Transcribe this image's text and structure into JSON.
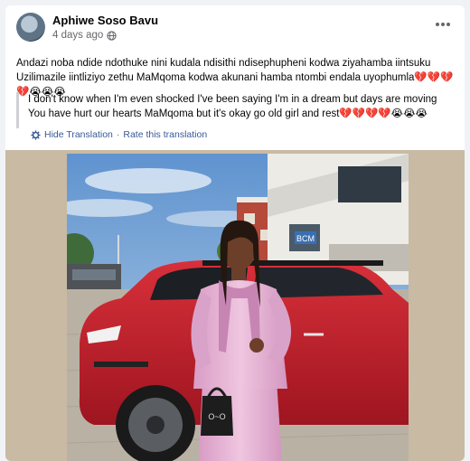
{
  "post": {
    "author": "Aphiwe Soso Bavu",
    "time": "4 days ago",
    "text_line1": "Andazi noba ndide ndothuke nini kudala ndisithi ndisephupheni kodwa ziyahamba iintsuku",
    "text_line2": "Uzilimazile iintliziyo zethu MaMqoma kodwa akunani hamba ntombi endala uyophumla",
    "emoji_line1_end": "💔💔💔",
    "emoji_line3": "💔😭😭😭",
    "translation_line1": "I don't know when I'm even shocked I've been saying I'm in a dream but days are moving",
    "translation_line2": "You have hurt our hearts MaMqoma but it's okay go old girl and rest",
    "translation_emoji": "💔💔💔💔😭😭😭",
    "hide_translation": "Hide Translation",
    "separator": "·",
    "rate_translation": "Rate this translation"
  },
  "photo": {
    "sign_text": "BCM",
    "bag_text": "O~O"
  },
  "icons": {
    "globe": "globe-icon",
    "more": "more-options-icon",
    "gear": "gear-icon"
  },
  "colors": {
    "link": "#385898",
    "heart": "#e41e3f",
    "car": "#c8202b",
    "outfit": "#e3b5d3"
  }
}
